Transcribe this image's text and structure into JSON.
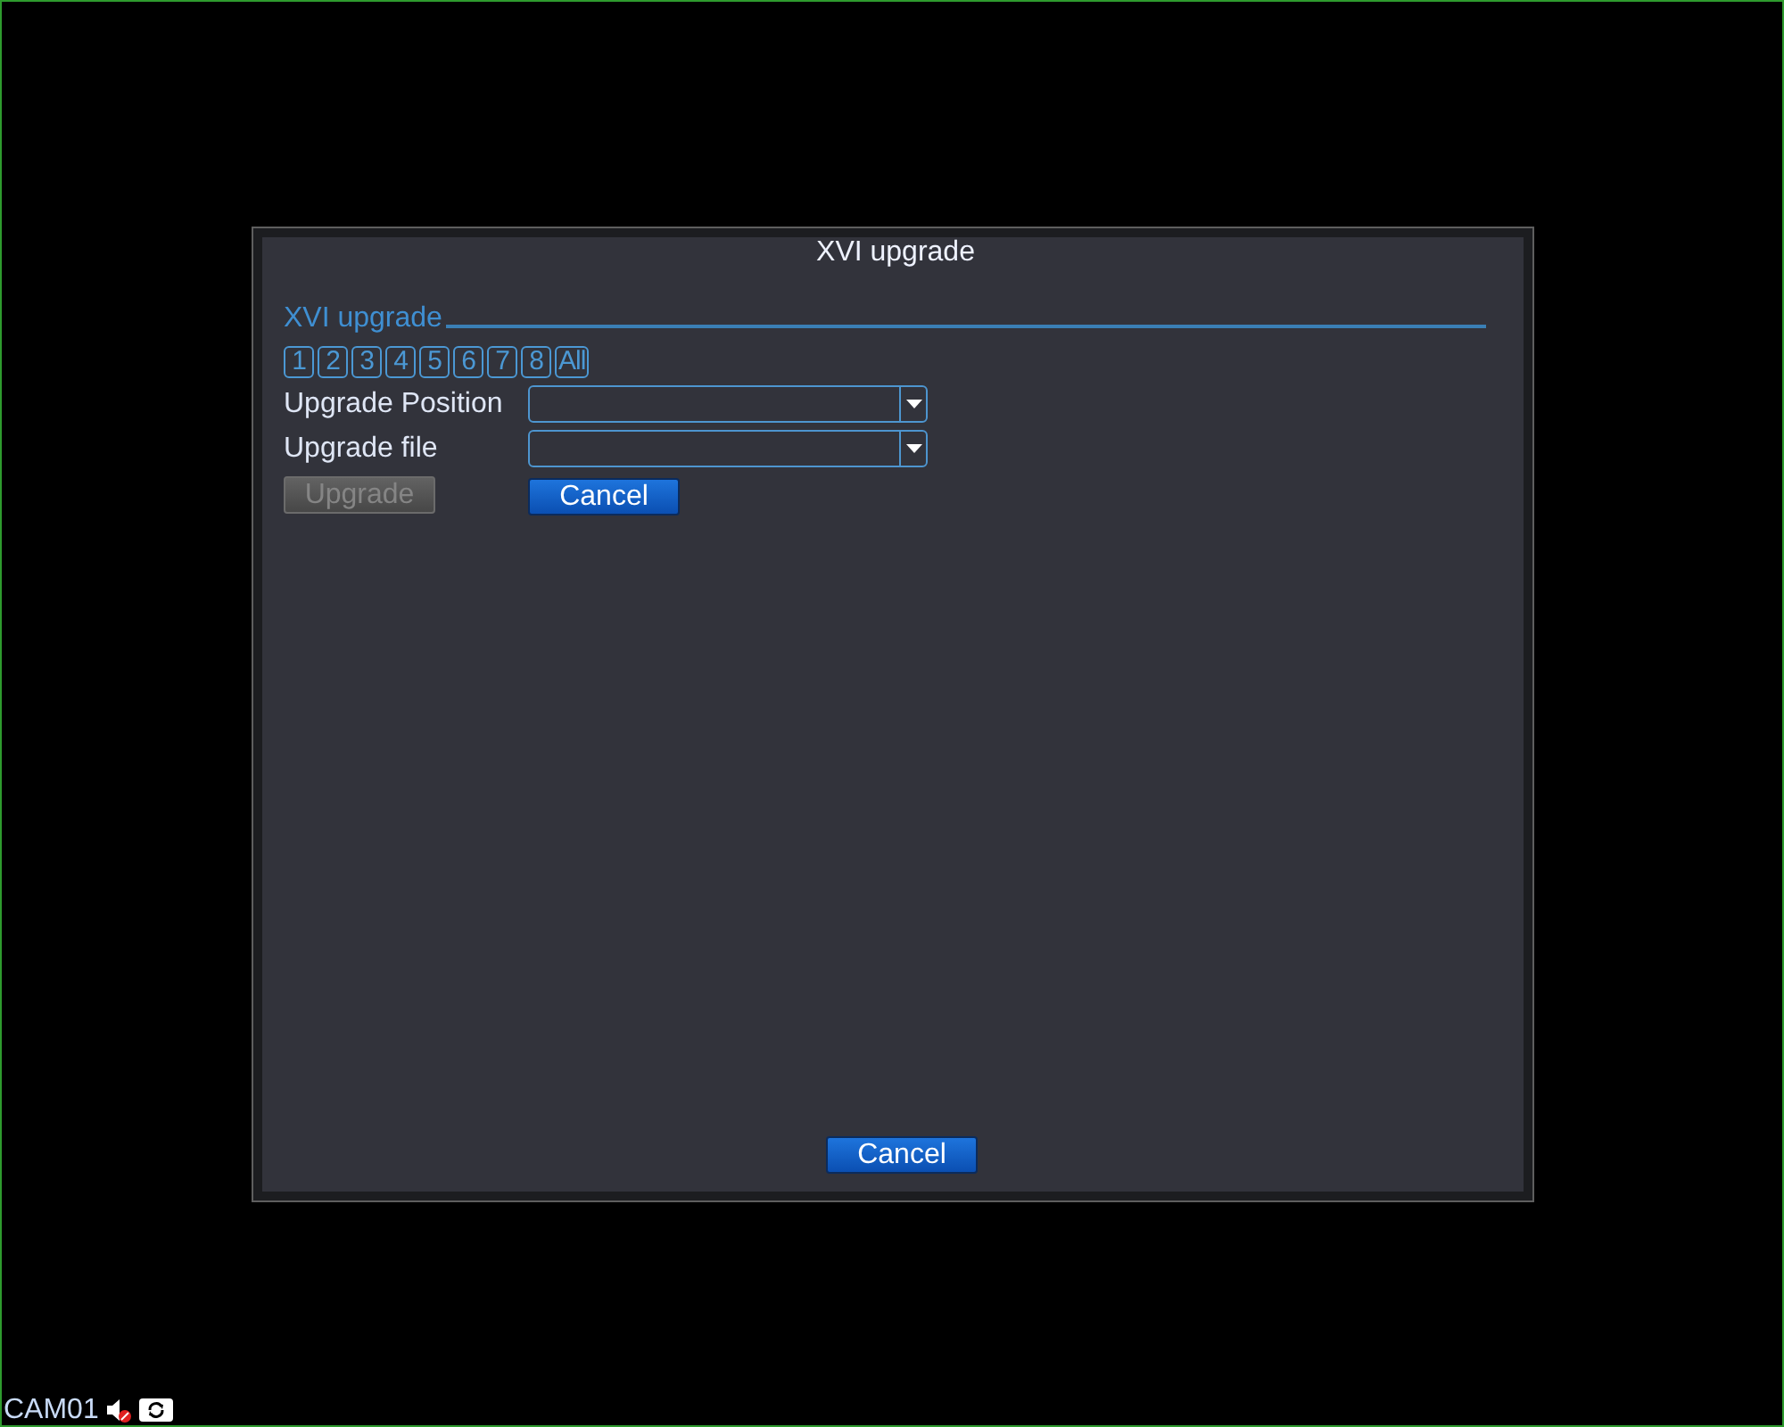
{
  "window": {
    "title": "XVI upgrade"
  },
  "section": {
    "title": "XVI upgrade"
  },
  "channels": [
    {
      "label": "1"
    },
    {
      "label": "2"
    },
    {
      "label": "3"
    },
    {
      "label": "4"
    },
    {
      "label": "5"
    },
    {
      "label": "6"
    },
    {
      "label": "7"
    },
    {
      "label": "8"
    },
    {
      "label": "All"
    }
  ],
  "fields": [
    {
      "label": "Upgrade Position"
    },
    {
      "label": "Upgrade file"
    }
  ],
  "buttons": [
    {
      "label": "Upgrade",
      "disabled": true
    },
    {
      "label": "Cancel",
      "disabled": false
    }
  ],
  "footer_button": {
    "label": "Cancel",
    "disabled": false
  },
  "status_bar": {
    "camera": "CAM01",
    "muted": true
  }
}
